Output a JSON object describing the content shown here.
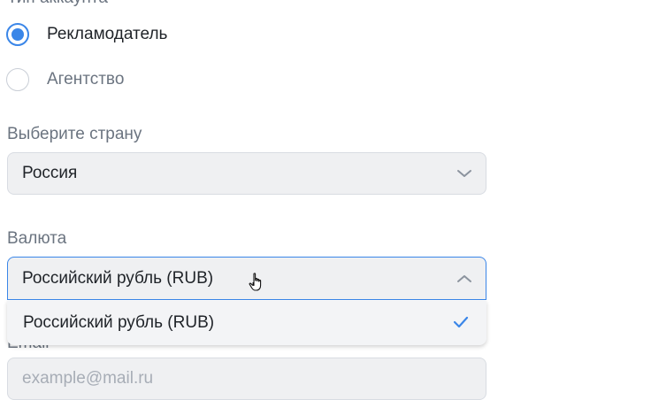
{
  "account_type": {
    "label": "Тип аккаунта",
    "options": [
      {
        "label": "Рекламодатель",
        "checked": true
      },
      {
        "label": "Агентство",
        "checked": false
      }
    ]
  },
  "country": {
    "label": "Выберите страну",
    "value": "Россия",
    "icon": "chevron-down-icon"
  },
  "currency": {
    "label": "Валюта",
    "value": "Российский рубль (RUB)",
    "icon": "chevron-up-icon",
    "open": true,
    "options": [
      {
        "label": "Российский рубль (RUB)",
        "selected": true,
        "icon": "checkmark-icon"
      }
    ]
  },
  "email": {
    "label": "Email",
    "placeholder": "example@mail.ru"
  },
  "colors": {
    "accent": "#3a86e8",
    "field_bg": "#eff0f2",
    "label_text": "#6b7480"
  }
}
